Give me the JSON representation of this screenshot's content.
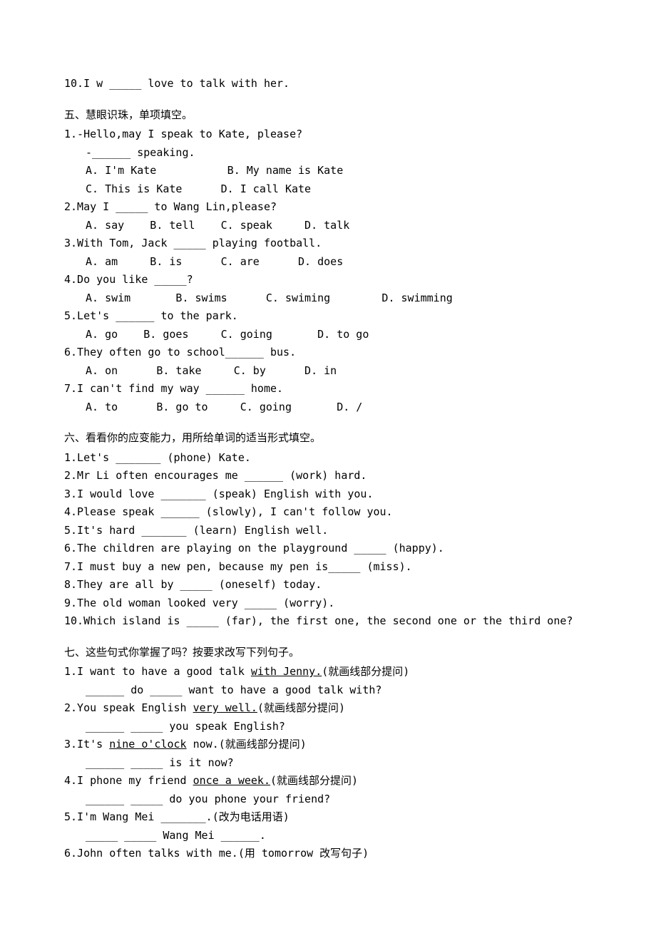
{
  "topLine": "10.I w _____ love to talk with her.",
  "sec5": {
    "title": "五、慧眼识珠，单项填空。",
    "q1l1": "1.-Hello,may I speak to Kate, please?",
    "q1l2": "-______ speaking.",
    "q1opts1": "A. I'm Kate           B. My name is Kate",
    "q1opts2": "C. This is Kate      D. I call Kate",
    "q2": "2.May I _____ to Wang Lin,please?",
    "q2opts": "A. say    B. tell    C. speak     D. talk",
    "q3": "3.With Tom, Jack _____ playing football.",
    "q3opts": "A. am     B. is      C. are      D. does",
    "q4": "4.Do you like _____?",
    "q4opts": "A. swim       B. swims      C. swiming        D. swimming",
    "q5": "5.Let's ______ to the park.",
    "q5opts": "A. go    B. goes     C. going       D. to go",
    "q6": "6.They often go to school______ bus.",
    "q6opts": "A. on      B. take     C. by      D. in",
    "q7": "7.I can't find my way ______ home.",
    "q7opts": "A. to      B. go to     C. going       D. /"
  },
  "sec6": {
    "title": "六、看看你的应变能力，用所给单词的适当形式填空。",
    "q1": "1.Let's _______ (phone) Kate.",
    "q2": "2.Mr Li often encourages me ______ (work) hard.",
    "q3": "3.I would love _______ (speak) English with you.",
    "q4": "4.Please speak ______ (slowly), I can't follow you.",
    "q5": "5.It's hard _______ (learn) English well.",
    "q6": "6.The children are playing on the playground _____ (happy).",
    "q7": "7.I must buy a new pen, because my pen is_____ (miss).",
    "q8": "8.They are all by _____ (oneself) today.",
    "q9": "9.The old woman looked very _____ (worry).",
    "q10": "10.Which island is _____ (far), the first one, the second one or the third one?"
  },
  "sec7": {
    "title": "七、这些句式你掌握了吗？按要求改写下列句子。",
    "q1a": "1.I want to have a good talk ",
    "q1u": "with Jenny.",
    "q1b": "(就画线部分提问)",
    "q1ans": "______ do _____ want to have a good talk with?",
    "q2a": "2.You speak English ",
    "q2u": "very well.",
    "q2b": "(就画线部分提问)",
    "q2ans": "______ _____ you speak English?",
    "q3a": "3.It's ",
    "q3u": "nine o'clock",
    "q3b": " now.(就画线部分提问)",
    "q3ans": "______ _____ is it now?",
    "q4a": "4.I phone my friend ",
    "q4u": "once a week.",
    "q4b": "(就画线部分提问)",
    "q4ans": "______ _____ do you phone your friend?",
    "q5": "5.I'm Wang Mei _______.(改为电话用语)",
    "q5ans": "_____ _____ Wang Mei ______.",
    "q6": "6.John often talks with me.(用 tomorrow 改写句子)"
  }
}
